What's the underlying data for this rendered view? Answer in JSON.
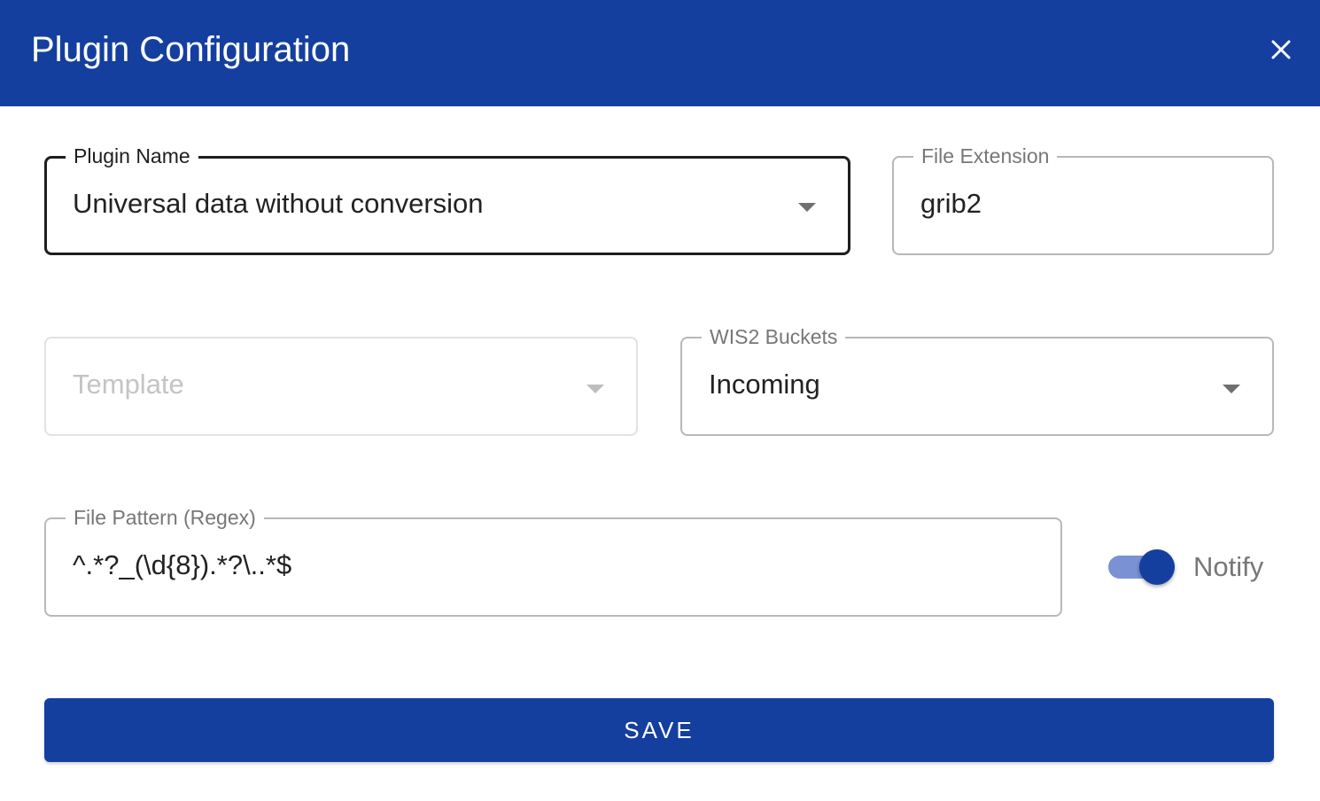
{
  "dialog": {
    "title": "Plugin Configuration",
    "close_icon": "close-icon"
  },
  "form": {
    "plugin_name": {
      "label": "Plugin Name",
      "value": "Universal data without conversion",
      "icon": "dropdown-caret-icon"
    },
    "file_extension": {
      "label": "File Extension",
      "value": "grib2"
    },
    "template": {
      "placeholder": "Template",
      "icon": "dropdown-caret-icon"
    },
    "wis2_buckets": {
      "label": "WIS2 Buckets",
      "value": "Incoming",
      "icon": "dropdown-caret-icon"
    },
    "file_pattern": {
      "label": "File Pattern (Regex)",
      "value": "^.*?_(\\d{8}).*?\\..*$"
    },
    "notify": {
      "label": "Notify",
      "enabled": true
    }
  },
  "actions": {
    "save_label": "SAVE"
  },
  "colors": {
    "primary": "#143f9f",
    "toggle_track": "#7a92d4"
  }
}
